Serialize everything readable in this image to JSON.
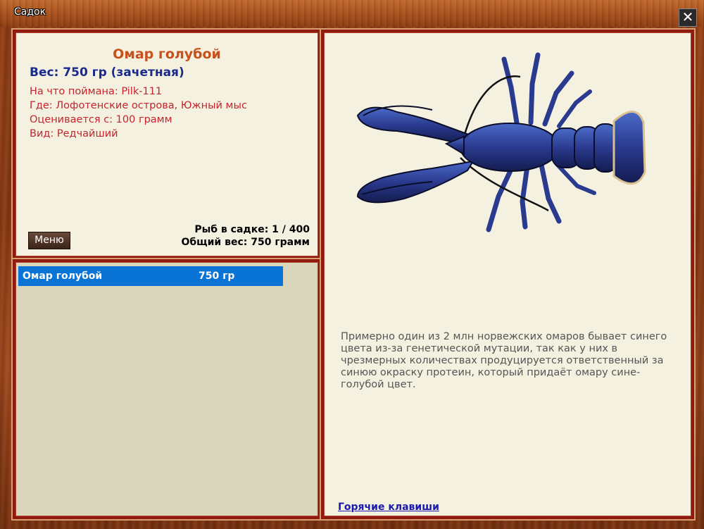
{
  "window": {
    "title": "Садок",
    "close_label": "✕"
  },
  "fish": {
    "name": "Омар голубой",
    "weight": "Вес: 750 гр (зачетная)",
    "caught_on": "На что поймана: Pilk-111",
    "location": "Где: Лофотенские острова, Южный мыс",
    "valued_from": "Оценивается с: 100 грамм",
    "rarity": "Вид: Редчайший"
  },
  "menu_button": "Меню",
  "stats": {
    "count": "Рыб в садке: 1 / 400",
    "total_weight": "Общий вес: 750 грамм"
  },
  "catch_list": [
    {
      "name": "Омар голубой",
      "weight": "750 гр"
    }
  ],
  "description": "Примерно один из 2 млн норвежских омаров бывает синего цвета из-за генетической мутации, так как у них в чрезмерных количествах продуцируется ответственный за синюю окраску протеин, который придаёт омару сине-голубой цвет.",
  "hotkeys_link": "Горячие клавиши",
  "colors": {
    "frame_red": "#8f1a10",
    "panel_bg": "#f5f1e0",
    "list_bg": "#d9d6bc",
    "selection": "#0a74d6",
    "fish_name": "#c8501a",
    "weight_text": "#1a2a8a",
    "info_text": "#c4242c"
  }
}
